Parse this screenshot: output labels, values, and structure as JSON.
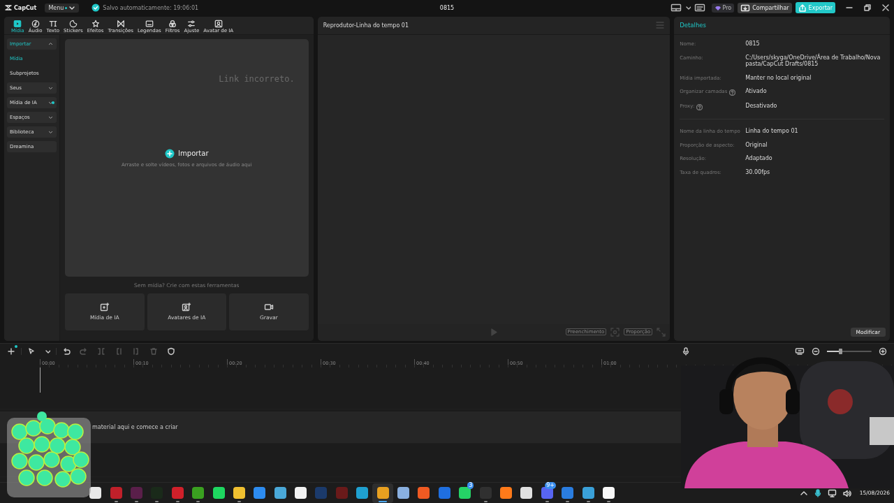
{
  "app": {
    "logo": "CapCut",
    "menu": "Menu",
    "saved": "Salvo automaticamente: 19:06:01",
    "title": "0815",
    "pro": "Pro",
    "share": "Compartilhar",
    "export": "Exportar"
  },
  "media_tabs": [
    {
      "label": "Mídia",
      "selected": true
    },
    {
      "label": "Áudio",
      "selected": false
    },
    {
      "label": "Texto",
      "selected": false
    },
    {
      "label": "Stickers",
      "selected": false
    },
    {
      "label": "Efeitos",
      "selected": false
    },
    {
      "label": "Transições",
      "selected": false
    },
    {
      "label": "Legendas",
      "selected": false
    },
    {
      "label": "Filtros",
      "selected": false
    },
    {
      "label": "Ajuste",
      "selected": false
    },
    {
      "label": "Avatar de IA",
      "selected": false
    }
  ],
  "sidebar": {
    "items": [
      {
        "label": "Importar",
        "kind": "group",
        "expanded": true,
        "new": false,
        "children": [
          {
            "label": "Mídia",
            "selected": true
          },
          {
            "label": "Subprojetos",
            "selected": false
          }
        ]
      },
      {
        "label": "Seus",
        "kind": "group",
        "expanded": false,
        "new": false
      },
      {
        "label": "Mídia de IA",
        "kind": "group",
        "expanded": false,
        "new": true
      },
      {
        "label": "Espaços",
        "kind": "group",
        "expanded": false,
        "new": false
      },
      {
        "label": "Biblioteca",
        "kind": "group",
        "expanded": false,
        "new": false
      },
      {
        "label": "Dreamina",
        "kind": "link"
      }
    ]
  },
  "import_area": {
    "notice": "Link incorreto.",
    "button": "Importar",
    "hint": "Arraste e solte vídeos, fotos e arquivos de áudio aqui"
  },
  "create_tools": {
    "heading": "Sem mídia? Crie com estas ferramentas",
    "cards": [
      "Mídia de IA",
      "Avatares de IA",
      "Gravar"
    ]
  },
  "player": {
    "title": "Reprodutor-Linha do tempo 01",
    "fill": "Preenchimento",
    "ratio": "Proporção"
  },
  "details": {
    "title": "Detalhes",
    "groups": [
      [
        {
          "label": "Nome:",
          "value": "0815",
          "help": false
        },
        {
          "label": "Caminho:",
          "value": "C:/Users/skyga/OneDrive/Área de Trabalho/Nova pasta/CapCut Drafts/0815",
          "help": false
        },
        {
          "label": "Mídia importada:",
          "value": "Manter no local original",
          "help": false
        },
        {
          "label": "Organizar camadas",
          "value": "Ativado",
          "help": true
        },
        {
          "label": "Proxy:",
          "value": "Desativado",
          "help": true
        }
      ],
      [
        {
          "label": "Nome da linha do tempo",
          "value": "Linha do tempo 01",
          "help": false
        },
        {
          "label": "Proporção de aspecto:",
          "value": "Original",
          "help": false
        },
        {
          "label": "Resolução:",
          "value": "Adaptado",
          "help": false
        },
        {
          "label": "Taxa de quadros:",
          "value": "30.00fps",
          "help": false
        }
      ]
    ],
    "button": "Modificar"
  },
  "timeline": {
    "tools": [
      {
        "disabled": false
      },
      {
        "disabled": false
      },
      {
        "disabled": false
      },
      {
        "disabled": true
      },
      {
        "disabled": true
      },
      {
        "disabled": true
      },
      {
        "disabled": true
      },
      {
        "disabled": true
      },
      {
        "disabled": false
      }
    ],
    "zoom": {
      "level": 0.3
    },
    "ruler": [
      "00:00",
      "00:10",
      "00:20",
      "00:30",
      "00:40",
      "00:50",
      "01:00"
    ],
    "track_hint": "material aqui e comece a criar"
  },
  "taskbar": {
    "apps": [
      {
        "color": "#e8e8e8",
        "running": false,
        "selected": false
      },
      {
        "color": "#c0202a",
        "running": true,
        "selected": false
      },
      {
        "color": "#5a1f4a",
        "running": true,
        "selected": false
      },
      {
        "color": "#1a2a1a",
        "running": true,
        "selected": false
      },
      {
        "color": "#d0202a",
        "running": true,
        "selected": false
      },
      {
        "color": "#3aa020",
        "running": true,
        "selected": false
      },
      {
        "color": "#1ed760",
        "running": false,
        "selected": false
      },
      {
        "color": "#f0c030",
        "running": true,
        "selected": false
      },
      {
        "color": "#2d8cf0",
        "running": false,
        "selected": false
      },
      {
        "color": "#4aa8d8",
        "running": false,
        "selected": false
      },
      {
        "color": "#f2f2f2",
        "running": false,
        "selected": false
      },
      {
        "color": "#1b3a6b",
        "running": false,
        "selected": false
      },
      {
        "color": "#6a1a1a",
        "running": false,
        "selected": false
      },
      {
        "color": "#1fa0d0",
        "running": false,
        "selected": false
      },
      {
        "color": "#e8a020",
        "running": true,
        "selected": true
      },
      {
        "color": "#8ab0e0",
        "running": false,
        "selected": false
      },
      {
        "color": "#f05a22",
        "running": false,
        "selected": false
      },
      {
        "color": "#1f6fe0",
        "running": false,
        "selected": false
      },
      {
        "color": "#25d366",
        "running": false,
        "selected": false,
        "badge": "3"
      },
      {
        "color": "#303030",
        "running": true,
        "selected": false
      },
      {
        "color": "#ff7a1a",
        "running": false,
        "selected": false
      },
      {
        "color": "#e0e0e0",
        "running": false,
        "selected": false
      },
      {
        "color": "#5865f2",
        "running": true,
        "selected": false,
        "badge": "9+"
      },
      {
        "color": "#2a7de0",
        "running": true,
        "selected": false
      },
      {
        "color": "#3aa0d8",
        "running": true,
        "selected": false
      },
      {
        "color": "#f8f8f8",
        "running": true,
        "selected": false
      }
    ],
    "date": "15/08/2026"
  }
}
